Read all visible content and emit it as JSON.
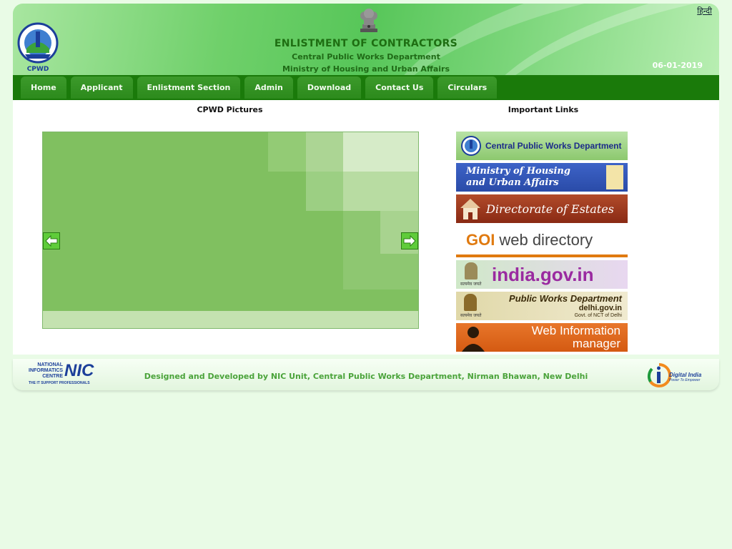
{
  "header": {
    "hindi_link": "हिन्दी",
    "title": "ENLISTMENT OF CONTRACTORS",
    "department": "Central Public Works Department",
    "ministry": "Ministry of Housing and Urban Affairs",
    "date": "06-01-2019",
    "cpwd_logo_text": "CPWD"
  },
  "nav": {
    "items": [
      "Home",
      "Applicant",
      "Enlistment Section",
      "Admin",
      "Download",
      "Contact Us",
      "Circulars"
    ]
  },
  "main": {
    "pictures_heading": "CPWD Pictures",
    "links_heading": "Important Links"
  },
  "links": [
    {
      "label": "Central Public Works Department"
    },
    {
      "label": "Ministry of Housing and Urban Affairs",
      "line1": "Ministry of Housing",
      "line2": "and Urban Affairs"
    },
    {
      "label": "Directorate of Estates"
    },
    {
      "label": "GOI web directory",
      "part1": "GOI",
      "part2": "web directory"
    },
    {
      "label": "india.gov.in",
      "tagline": "सत्यमेव जयते"
    },
    {
      "label": "Public Works Department delhi.gov.in Govt. of NCT of Delhi",
      "line1": "Public Works Department",
      "line2": "delhi.gov.in",
      "line3": "Govt. of NCT of Delhi",
      "tagline": "सत्यमेव जयते"
    },
    {
      "label": "Web Information manager",
      "line1": "Web Information",
      "line2": "manager"
    }
  ],
  "footer": {
    "credit": "Designed and Developed by NIC Unit, Central Public Works Department, Nirman Bhawan, New Delhi",
    "nic_line1": "NATIONAL",
    "nic_line2": "INFORMATICS",
    "nic_line3": "CENTRE",
    "nic_abbr": "NIC",
    "nic_tagline": "THE IT SUPPORT PROFESSIONALS",
    "digital_india": "Digital India",
    "digital_india_tagline": "Power To Empower"
  },
  "colors": {
    "nav_bg": "#1a7a0a",
    "nav_tab": "#3c9a2b",
    "title_green": "#1e6e12",
    "footer_text": "#4aa33a",
    "page_bg": "#e9fbe6"
  }
}
